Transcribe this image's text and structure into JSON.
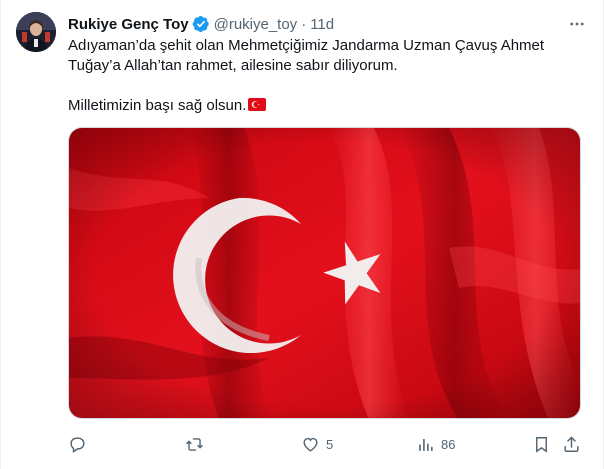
{
  "tweet": {
    "author_name": "Rukiye Genç Toy",
    "handle": "@rukiye_toy",
    "separator": "·",
    "time": "11d",
    "text_line1": "Adıyaman’da şehit olan Mehmetçiğimiz Jandarma Uzman Çavuş Ahmet",
    "text_line2": "Tuğay’a Allah’tan rahmet, ailesine sabır diliyorum.",
    "text_line3": "Milletimizin başı sağ olsun.",
    "flag_emoji_name": "turkey-flag-emoji",
    "media": {
      "description_icon": "turkish-flag-image"
    }
  },
  "actions": {
    "reply": {
      "icon": "reply-icon",
      "count": ""
    },
    "retweet": {
      "icon": "retweet-icon",
      "count": ""
    },
    "like": {
      "icon": "heart-icon",
      "count": "5"
    },
    "views": {
      "icon": "views-icon",
      "count": "86"
    },
    "bookmark": {
      "icon": "bookmark-icon"
    },
    "share": {
      "icon": "share-icon"
    }
  },
  "colors": {
    "text": "#0f1419",
    "secondary": "#536471",
    "verified": "#1d9bf0",
    "flag_red": "#e30a17"
  }
}
